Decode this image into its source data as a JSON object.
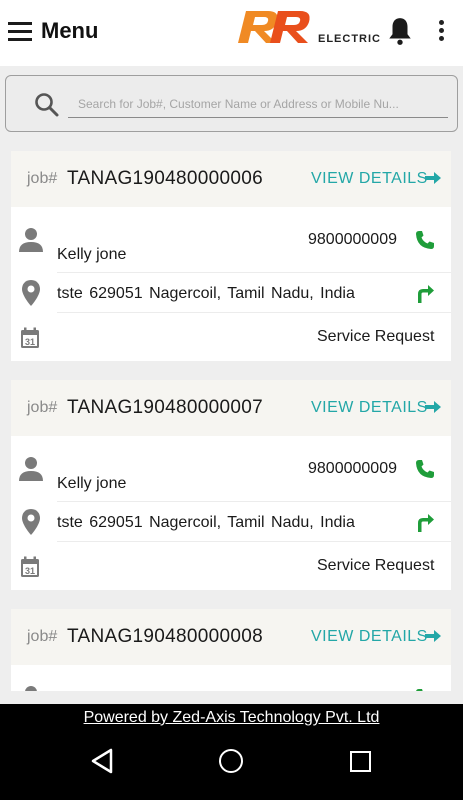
{
  "header": {
    "title": "Menu",
    "logo_text": "ELECTRIC",
    "brand_colors": {
      "primary": "#e94f1c",
      "secondary": "#f08a24"
    }
  },
  "search": {
    "placeholder": "Search for Job#, Customer Name or Address or Mobile Nu..."
  },
  "jobs": [
    {
      "job_label": "job#",
      "job_number": "TANAG190480000006",
      "view_details": "VIEW DETAILS",
      "customer_name": "Kelly  jone",
      "mobile": "9800000009",
      "address": "tste   629051 Nagercoil, Tamil Nadu, India",
      "service_type": "Service Request"
    },
    {
      "job_label": "job#",
      "job_number": "TANAG190480000007",
      "view_details": "VIEW DETAILS",
      "customer_name": "Kelly  jone",
      "mobile": "9800000009",
      "address": "tste   629051 Nagercoil, Tamil Nadu, India",
      "service_type": "Service Request"
    },
    {
      "job_label": "job#",
      "job_number": "TANAG190480000008",
      "view_details": "VIEW DETAILS"
    }
  ],
  "footer": {
    "powered_by": "Powered by Zed-Axis Technology Pvt. Ltd"
  },
  "colors": {
    "accent": "#23a7a7",
    "phone_green": "#1f9d3a",
    "icon_gray": "#7a7a7a"
  }
}
